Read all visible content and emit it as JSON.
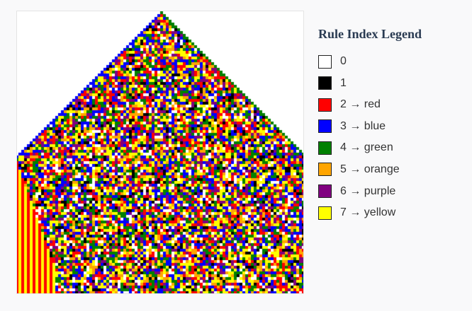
{
  "legend": {
    "title": "Rule Index Legend",
    "items": [
      {
        "label": "0",
        "color": "#ffffff"
      },
      {
        "label": "1",
        "color": "#000000"
      },
      {
        "label": "2 → red",
        "color": "#ff0000"
      },
      {
        "label": "3 → blue",
        "color": "#0000ff"
      },
      {
        "label": "4 → green",
        "color": "#008000"
      },
      {
        "label": "5 → orange",
        "color": "#ffa500"
      },
      {
        "label": "6 → purple",
        "color": "#800080"
      },
      {
        "label": "7 → yellow",
        "color": "#ffff00"
      }
    ]
  }
}
